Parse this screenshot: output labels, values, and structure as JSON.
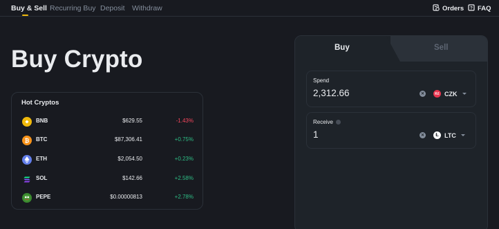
{
  "nav": {
    "tabs": [
      {
        "label": "Buy & Sell",
        "active": true
      },
      {
        "label": "Recurring Buy",
        "active": false
      },
      {
        "label": "Deposit",
        "active": false
      },
      {
        "label": "Withdraw",
        "active": false
      }
    ],
    "orders_label": "Orders",
    "faq_label": "FAQ",
    "accent_color": "#f0b90b"
  },
  "page": {
    "title": "Buy Crypto"
  },
  "hot_cryptos": {
    "title": "Hot Cryptos",
    "coins": [
      {
        "symbol": "BNB",
        "price": "$629.55",
        "change": "-1.43%",
        "direction": "down",
        "icon": "bnb-icon",
        "color": "#f0b90b"
      },
      {
        "symbol": "BTC",
        "price": "$87,306.41",
        "change": "+0.75%",
        "direction": "up",
        "icon": "btc-icon",
        "color": "#f7931a"
      },
      {
        "symbol": "ETH",
        "price": "$2,054.50",
        "change": "+0.23%",
        "direction": "up",
        "icon": "eth-icon",
        "color": "#627eea"
      },
      {
        "symbol": "SOL",
        "price": "$142.66",
        "change": "+2.58%",
        "direction": "up",
        "icon": "sol-icon",
        "color": "#14f195"
      },
      {
        "symbol": "PEPE",
        "price": "$0.00000813",
        "change": "+2.78%",
        "direction": "up",
        "icon": "pepe-icon",
        "color": "#3a8a2f"
      }
    ]
  },
  "trade": {
    "buy_tab": "Buy",
    "sell_tab": "Sell",
    "active_tab": "Buy",
    "spend": {
      "label": "Spend",
      "value": "2,312.66",
      "currency": "CZK",
      "currency_icon_text": "Kč",
      "currency_color": "#e8344e"
    },
    "receive": {
      "label": "Receive",
      "value": "1",
      "currency": "LTC",
      "currency_icon_text": "Ł",
      "currency_color": "#ffffff"
    }
  }
}
